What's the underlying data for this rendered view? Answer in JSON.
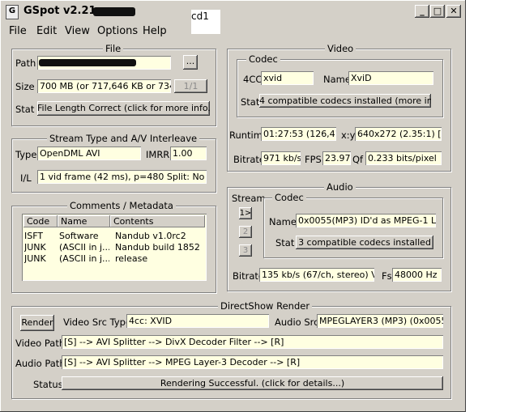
{
  "window": {
    "title": "GSpot v2.21:",
    "overlay_label": "cd1"
  },
  "menu": [
    "File",
    "Edit",
    "View",
    "Options",
    "Help"
  ],
  "file": {
    "group_title": "File",
    "path_label": "Path",
    "path_browse": "...",
    "size_label": "Size",
    "size_value": "700 MB (or 717,646 KB or 734,86",
    "size_button": "1/1",
    "stat_label": "Stat",
    "stat_value": "File Length Correct (click for more info...)"
  },
  "stream": {
    "group_title": "Stream Type and A/V Interleave",
    "type_label": "Type",
    "type_value": "OpenDML AVI",
    "imrr_label": "IMRR",
    "imrr_value": "1.00",
    "il_label": "I/L",
    "il_value": "1 vid frame (42 ms), p=480  Split: No"
  },
  "comments": {
    "group_title": "Comments / Metadata",
    "columns": [
      "Code",
      "Name",
      "Contents"
    ],
    "rows": [
      [
        "ISFT",
        "Software",
        "Nandub v1.0rc2"
      ],
      [
        "JUNK",
        "(ASCII in j...",
        "Nandub build 1852"
      ],
      [
        "JUNK",
        "(ASCII in j...",
        "release"
      ]
    ]
  },
  "video": {
    "group_title": "Video",
    "codec_title": "Codec",
    "fourcc_label": "4CC",
    "fourcc_value": "xvid",
    "name_label": "Name",
    "name_value": "XviD",
    "stat_label": "Stat",
    "stat_value": "4 compatible codecs installed (more info...)",
    "runtime_label": "Runtime",
    "runtime_value": "01:27:53 (126,417",
    "xy_label": "x:y",
    "xy_value": "640x272 (2.35:1) [=40",
    "bitrate_label": "Bitrate",
    "bitrate_value": "971 kb/s",
    "fps_label": "FPS",
    "fps_value": "23.97",
    "qf_label": "Qf",
    "qf_value": "0.233 bits/pixel"
  },
  "audio": {
    "group_title": "Audio",
    "stream_title": "Stream",
    "stream_buttons": [
      "1>",
      "2",
      "3"
    ],
    "codec_title": "Codec",
    "name_label": "Name",
    "name_value": "0x0055(MP3) ID'd as MPEG-1 Lay",
    "stat_label": "Stat",
    "stat_value": "3 compatible codecs installed",
    "bitrate_label": "Bitrate",
    "bitrate_value": "135 kb/s (67/ch, stereo) VB",
    "fs_label": "Fs",
    "fs_value": "48000 Hz"
  },
  "directshow": {
    "group_title": "DirectShow Render",
    "render_button": "Render",
    "video_src_type_label": "Video Src Type",
    "video_src_type_value": "4cc: XVID",
    "audio_src_label": "Audio Src",
    "audio_src_value": "MPEGLAYER3 (MP3) (0x0055)",
    "video_path_label": "Video Path",
    "video_path_value": "[S] --> AVI Splitter --> DivX Decoder Filter --> [R]",
    "audio_path_label": "Audio Path",
    "audio_path_value": "[S] --> AVI Splitter --> MPEG Layer-3 Decoder --> [R]",
    "status_label": "Status",
    "status_value": "Rendering Successful.  (click for details...)"
  }
}
